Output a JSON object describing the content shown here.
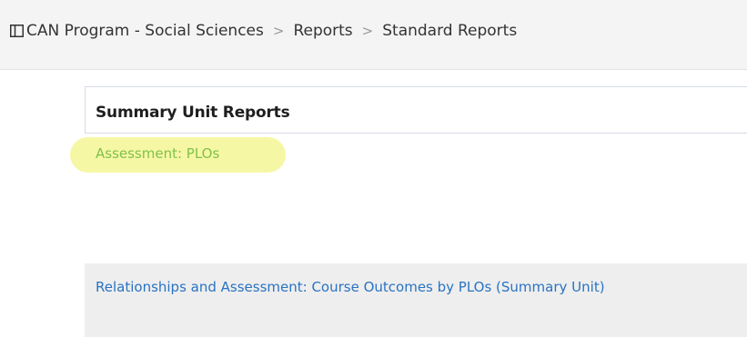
{
  "breadcrumb": {
    "icon": "panel-icon",
    "items": [
      "CAN Program - Social Sciences",
      "Reports",
      "Standard Reports"
    ],
    "separator": ">"
  },
  "card": {
    "title": "Summary Unit Reports"
  },
  "links": {
    "highlighted": "Assessment: PLOs",
    "report": "Relationships and Assessment: Course Outcomes by PLOs (Summary Unit)"
  },
  "colors": {
    "highlight": "#f6f7a5",
    "highlighted_link": "#7ec24a",
    "link": "#2a73c2"
  }
}
